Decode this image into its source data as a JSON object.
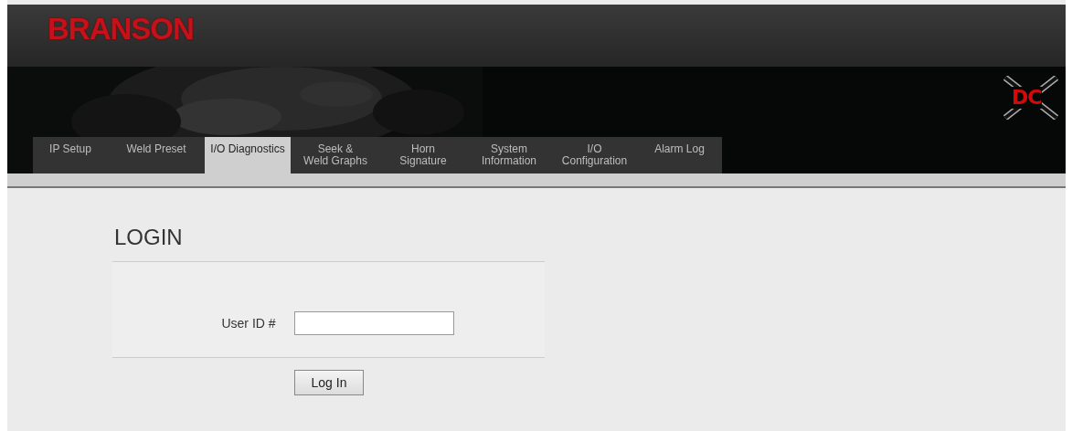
{
  "header": {
    "brand": "BRANSON",
    "product_logo": "DC"
  },
  "tabs": [
    {
      "label": "IP Setup",
      "selected": false
    },
    {
      "label": "Weld Preset",
      "selected": false
    },
    {
      "label": "I/O Diagnostics",
      "selected": true
    },
    {
      "label": "Seek &\nWeld Graphs",
      "selected": false
    },
    {
      "label": "Horn\nSignature",
      "selected": false
    },
    {
      "label": "System\nInformation",
      "selected": false
    },
    {
      "label": "I/O\nConfiguration",
      "selected": false
    },
    {
      "label": "Alarm Log",
      "selected": false
    }
  ],
  "login": {
    "title": "LOGIN",
    "field_label": "User ID #",
    "button": "Log In"
  }
}
